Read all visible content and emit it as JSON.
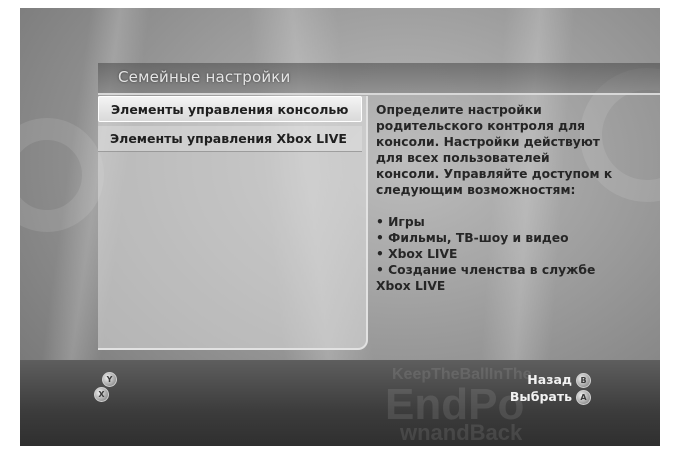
{
  "header": {
    "title": "Семейные настройки"
  },
  "menu": {
    "items": [
      {
        "label": "Элементы управления консолью",
        "selected": true
      },
      {
        "label": "Элементы управления Xbox LIVE",
        "selected": false
      }
    ]
  },
  "description": {
    "intro": "Определите настройки родительского контроля для консоли. Настройки действуют для всех пользователей консоли. Управляйте доступом к следующим возможностям:",
    "bullets": [
      "• Игры",
      "• Фильмы, ТВ-шоу и видео",
      "• Xbox LIVE",
      "• Создание членства в службе Xbox LIVE"
    ]
  },
  "footer": {
    "back_label": "Назад",
    "back_button_glyph": "B",
    "select_label": "Выбрать",
    "select_button_glyph": "A",
    "y_button_glyph": "Y",
    "x_button_glyph": "X"
  },
  "background": {
    "words": [
      "KeepTheBallInThe",
      "EndPo",
      "wnandBack"
    ]
  }
}
